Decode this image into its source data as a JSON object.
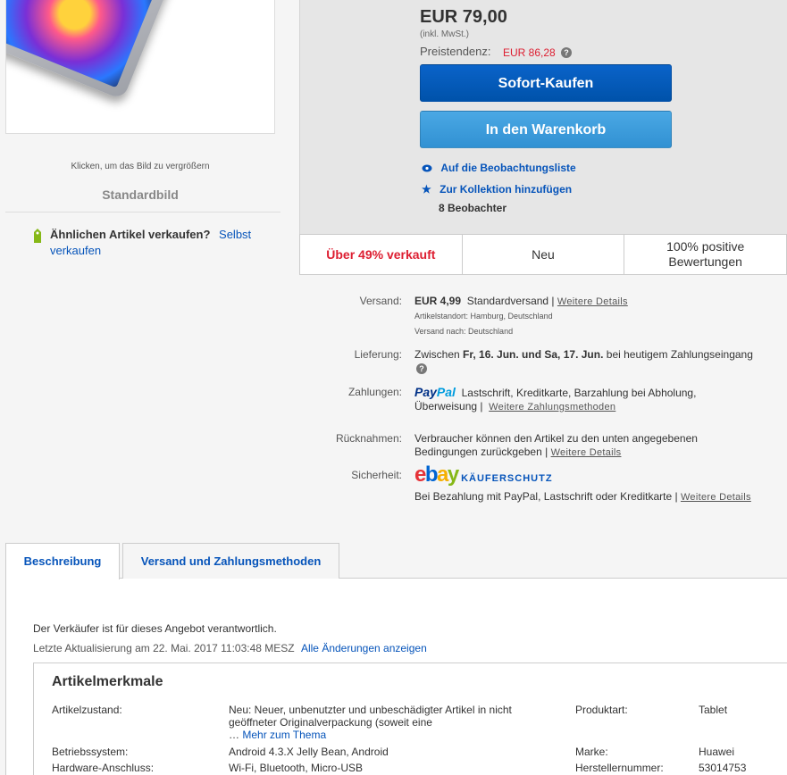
{
  "image": {
    "enlarge_hint": "Klicken, um das Bild zu vergrößern",
    "standard_image": "Standardbild"
  },
  "sell_similar": {
    "question": "Ähnlichen Artikel verkaufen?",
    "link": "Selbst verkaufen"
  },
  "buy_box": {
    "price": "EUR 79,00",
    "vat": "(inkl. MwSt.)",
    "trend_label": "Preistendenz:",
    "trend_value": "EUR 86,28",
    "buy_now": "Sofort-Kaufen",
    "add_to_cart": "In den Warenkorb",
    "watch": "Auf die Beobachtungsliste",
    "collection": "Zur Kollektion hinzufügen",
    "watchers": "8 Beobachter"
  },
  "strip": {
    "sold": "Über 49% verkauft",
    "condition": "Neu",
    "feedback": "100% positive Bewertungen"
  },
  "shipping": {
    "label": "Versand:",
    "cost": "EUR 4,99",
    "method": "Standardversand |",
    "link": "Weitere Details",
    "location": "Artikelstandort:  Hamburg, Deutschland",
    "ships_to": "Versand nach:  Deutschland"
  },
  "delivery": {
    "label": "Lieferung:",
    "prefix": "Zwischen",
    "dates": "Fr, 16. Jun. und Sa, 17. Jun.",
    "suffix": "bei heutigem Zahlungseingang"
  },
  "payments": {
    "label": "Zahlungen:",
    "paypal_a": "Pay",
    "paypal_b": "Pal",
    "methods": "Lastschrift,  Kreditkarte,  Barzahlung bei Abholung,",
    "transfer": "Überweisung  |",
    "link": "Weitere Zahlungsmethoden"
  },
  "returns": {
    "label": "Rücknahmen:",
    "line1": "Verbraucher können den Artikel zu den unten angegebenen",
    "line2": "Bedingungen zurückgeben |",
    "link": "Weitere Details"
  },
  "security": {
    "label": "Sicherheit:",
    "ebay_e": "e",
    "ebay_b": "b",
    "ebay_a": "a",
    "ebay_y": "y",
    "protection": "KÄUFERSCHUTZ",
    "text": "Bei Bezahlung mit PayPal, Lastschrift oder Kreditkarte |",
    "link": "Weitere Details"
  },
  "tabs": [
    "Beschreibung",
    "Versand und Zahlungsmethoden"
  ],
  "description": {
    "responsible": "Der Verkäufer ist für dieses Angebot verantwortlich.",
    "updated_label": "Letzte Aktualisierung am  22. Mai. 2017 11:03:48 MESZ",
    "changes_link": "Alle Änderungen anzeigen"
  },
  "specs": {
    "title": "Artikelmerkmale",
    "condition_label": "Artikelzustand:",
    "condition_value": "Neu: Neuer, unbenutzter und unbeschädigter Artikel in nicht geöffneter Originalverpackung (soweit eine",
    "more": "Mehr zum Thema",
    "os_label": "Betriebssystem:",
    "os_value": "Android 4.3.X Jelly Bean, Android",
    "hw_label": "Hardware-Anschluss:",
    "hw_value": "Wi-Fi, Bluetooth, Micro-USB",
    "type_label": "Produktart:",
    "type_value": "Tablet",
    "brand_label": "Marke:",
    "brand_value": "Huawei",
    "mpn_label": "Herstellernummer:",
    "mpn_value": "53014753"
  }
}
